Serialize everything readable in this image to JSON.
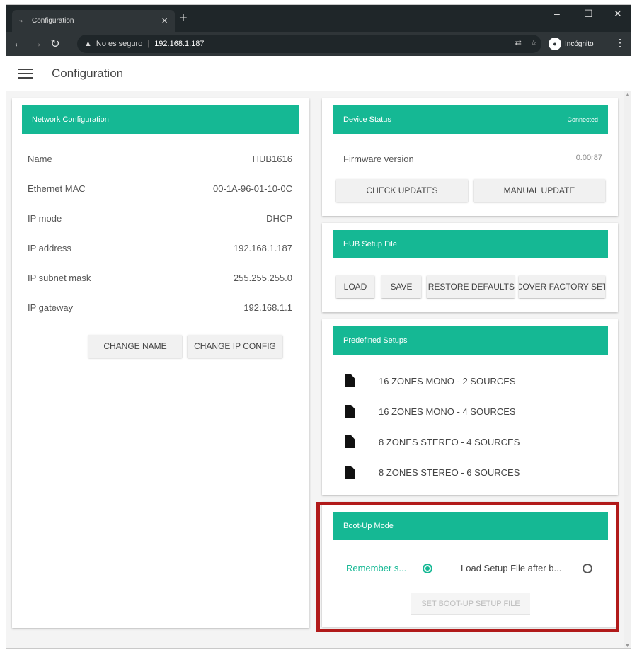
{
  "browser": {
    "tab_title": "Configuration",
    "tab_close": "×",
    "new_tab": "+",
    "security_label": "No es seguro",
    "url": "192.168.1.187",
    "incognito_label": "Incógnito",
    "icons": [
      "back-icon",
      "forward-icon",
      "reload-icon",
      "warning-icon",
      "translate-icon",
      "star-icon",
      "incognito-icon",
      "menu-icon"
    ]
  },
  "app": {
    "title": "Configuration",
    "accent_color": "#15b894",
    "highlight_color": "#b11a1a"
  },
  "network": {
    "header": "Network Configuration",
    "rows": [
      {
        "label": "Name",
        "value": "HUB1616"
      },
      {
        "label": "Ethernet MAC",
        "value": "00-1A-96-01-10-0C"
      },
      {
        "label": "IP mode",
        "value": "DHCP"
      },
      {
        "label": "IP address",
        "value": "192.168.1.187"
      },
      {
        "label": "IP subnet mask",
        "value": "255.255.255.0"
      },
      {
        "label": "IP gateway",
        "value": "192.168.1.1"
      }
    ],
    "change_name": "CHANGE NAME",
    "change_ip": "CHANGE IP CONFIG"
  },
  "device_status": {
    "header": "Device Status",
    "status": "Connected",
    "firmware_label": "Firmware version",
    "firmware_value": "0.00r87",
    "check_updates": "CHECK UPDATES",
    "manual_update": "MANUAL UPDATE"
  },
  "hub_setup": {
    "header": "HUB Setup File",
    "load": "LOAD",
    "save": "SAVE",
    "restore_defaults": "RESTORE DEFAULTS",
    "recover_factory": "RECOVER FACTORY SETUP"
  },
  "predefined": {
    "header": "Predefined Setups",
    "items": [
      "16 ZONES MONO - 2 SOURCES",
      "16 ZONES MONO - 4 SOURCES",
      "8 ZONES STEREO - 4 SOURCES",
      "8 ZONES STEREO - 6 SOURCES"
    ]
  },
  "bootup": {
    "header": "Boot-Up Mode",
    "option_remember": "Remember s...",
    "option_load": "Load Setup File after b...",
    "selected": "remember",
    "set_button": "SET BOOT-UP SETUP FILE"
  }
}
